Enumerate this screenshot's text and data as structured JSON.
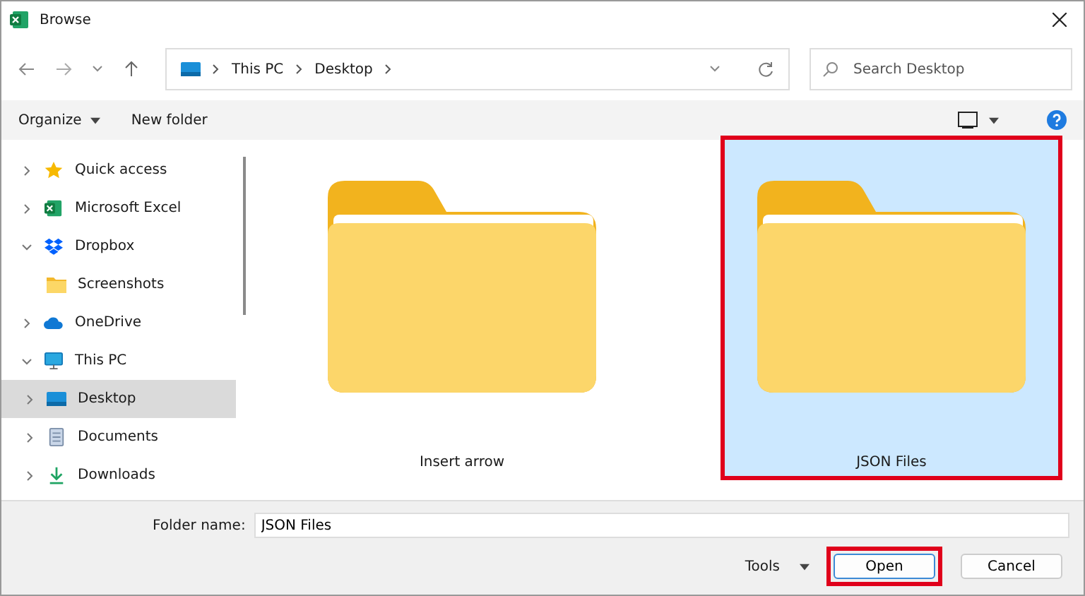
{
  "window": {
    "title": "Browse"
  },
  "address": {
    "path": [
      "This PC",
      "Desktop"
    ]
  },
  "search": {
    "placeholder": "Search Desktop"
  },
  "toolbar": {
    "items": [
      "Organize",
      "New folder"
    ]
  },
  "sidebar": {
    "items": [
      {
        "label": "Quick access",
        "kind": "star",
        "expanded": false,
        "selected": false
      },
      {
        "label": "Microsoft Excel",
        "kind": "excel",
        "expanded": false,
        "selected": false
      },
      {
        "label": "Dropbox",
        "kind": "dropbox",
        "expanded": true,
        "selected": false,
        "children": [
          {
            "label": "Screenshots",
            "kind": "folder",
            "selected": false
          }
        ]
      },
      {
        "label": "OneDrive",
        "kind": "cloud",
        "expanded": false,
        "selected": false
      },
      {
        "label": "This PC",
        "kind": "pc",
        "expanded": true,
        "selected": false,
        "children": [
          {
            "label": "Desktop",
            "kind": "desktop",
            "selected": true,
            "expanded": false
          },
          {
            "label": "Documents",
            "kind": "doc",
            "selected": false,
            "expanded": false
          },
          {
            "label": "Downloads",
            "kind": "download",
            "selected": false,
            "expanded": false
          }
        ]
      }
    ]
  },
  "files": [
    {
      "name": "Insert arrow",
      "selected": false,
      "highlighted": false
    },
    {
      "name": "JSON Files",
      "selected": true,
      "highlighted": true
    }
  ],
  "footer": {
    "folder_label": "Folder name:",
    "folder_value": "JSON Files",
    "tools": "Tools",
    "buttons": [
      {
        "label": "Open",
        "kind": "primary",
        "highlighted": true
      },
      {
        "label": "Cancel",
        "kind": "normal",
        "highlighted": false
      }
    ]
  }
}
